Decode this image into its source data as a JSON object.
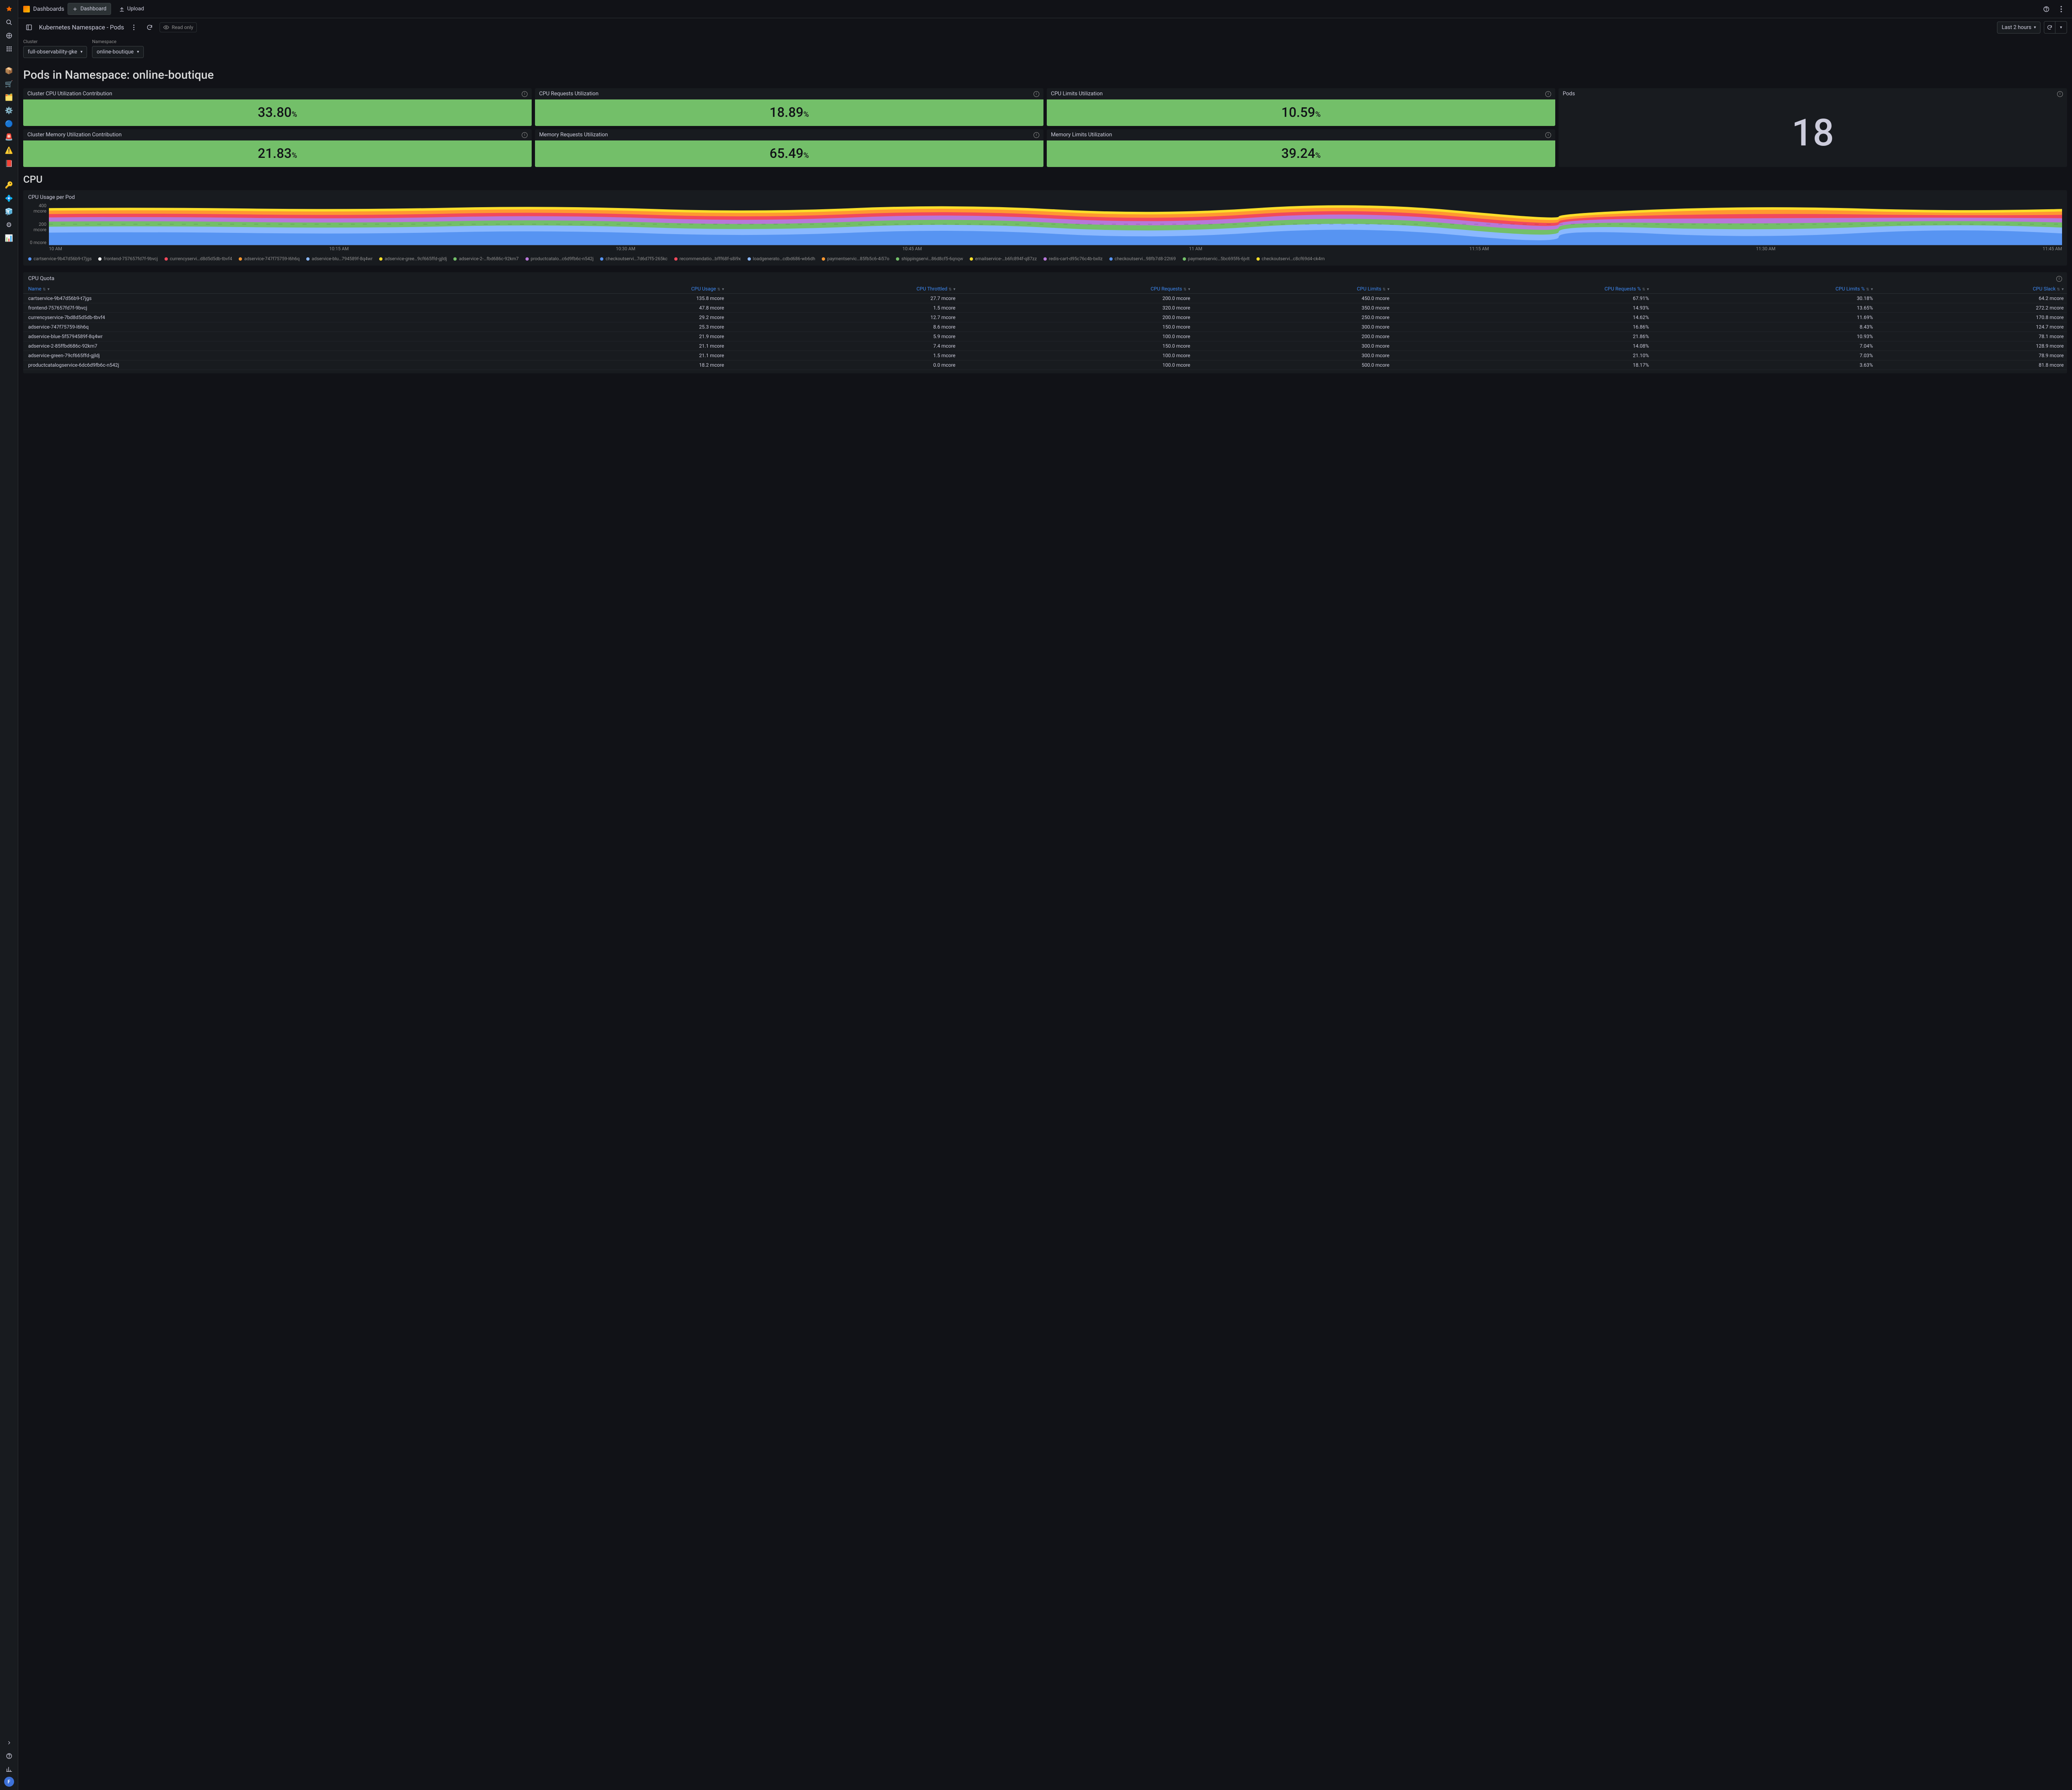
{
  "topbar": {
    "breadcrumb_root": "Dashboards",
    "new_dashboard": "Dashboard",
    "upload": "Upload"
  },
  "subheader": {
    "title": "Kubernetes Namespace - Pods",
    "readonly": "Read only",
    "timerange": "Last 2 hours"
  },
  "vars": {
    "cluster_label": "Cluster",
    "cluster_value": "full-observability-gke",
    "namespace_label": "Namespace",
    "namespace_value": "online-boutique"
  },
  "page_heading": "Pods in Namespace: online-boutique",
  "stats": {
    "cpu_cluster": {
      "title": "Cluster CPU Utilization Contribution",
      "value": "33.80",
      "suffix": "%"
    },
    "cpu_requests": {
      "title": "CPU Requests Utilization",
      "value": "18.89",
      "suffix": "%"
    },
    "cpu_limits": {
      "title": "CPU Limits Utilization",
      "value": "10.59",
      "suffix": "%"
    },
    "mem_cluster": {
      "title": "Cluster Memory Utilization Contribution",
      "value": "21.83",
      "suffix": "%"
    },
    "mem_requests": {
      "title": "Memory Requests Utilization",
      "value": "65.49",
      "suffix": "%"
    },
    "mem_limits": {
      "title": "Memory Limits Utilization",
      "value": "39.24",
      "suffix": "%"
    },
    "pods": {
      "title": "Pods",
      "value": "18"
    }
  },
  "section_cpu": "CPU",
  "chart": {
    "title": "CPU Usage per Pod",
    "ylabels": [
      "400 mcore",
      "200 mcore",
      "0 mcore"
    ],
    "xlabels": [
      "10 AM",
      "10:15 AM",
      "10:30 AM",
      "10:45 AM",
      "11 AM",
      "11:15 AM",
      "11:30 AM",
      "11:45 AM"
    ]
  },
  "legend": [
    {
      "c": "#5794f2",
      "t": "cartservice-9b47d56b9-t7jgs"
    },
    {
      "c": "#ffffff",
      "t": "frontend-757657fd7f-9bvcj"
    },
    {
      "c": "#f2495c",
      "t": "currencyservi…d8d5d5db-tbvf4"
    },
    {
      "c": "#ff9830",
      "t": "adservice-747f75759-l6h6q"
    },
    {
      "c": "#8ab8ff",
      "t": "adservice-blu…794589f-8q4wr"
    },
    {
      "c": "#fade2a",
      "t": "adservice-gree…9cf665ffd-gjldj"
    },
    {
      "c": "#73bf69",
      "t": "adservice-2-…fbd686c-92km7"
    },
    {
      "c": "#b877d9",
      "t": "productcatalo…c6d9fb6c-n542j"
    },
    {
      "c": "#5794f2",
      "t": "checkoutservi…7d6d7f5-265kc"
    },
    {
      "c": "#f2495c",
      "t": "recommendatio…bfff68f-s8i9x"
    },
    {
      "c": "#8ab8ff",
      "t": "loadgenerato…cdbd686-wb6dh"
    },
    {
      "c": "#ff9830",
      "t": "paymentservic…85fb5c6-4i57o"
    },
    {
      "c": "#73bf69",
      "t": "shippingservi…86d8cf5-6qnqw"
    },
    {
      "c": "#fade2a",
      "t": "emailservice-…b6fc894f-q87zz"
    },
    {
      "c": "#b877d9",
      "t": "redis-cart-d95c76c4b-bxllz"
    },
    {
      "c": "#5794f2",
      "t": "checkoutservi…98fb7d8-22t69"
    },
    {
      "c": "#73bf69",
      "t": "paymentservic…5bc695f6-6jvlt"
    },
    {
      "c": "#fade2a",
      "t": "checkoutservi…c8cf69d4-ck4rn"
    }
  ],
  "table": {
    "title": "CPU Quota",
    "headers": [
      "Name",
      "CPU Usage",
      "CPU Throttled",
      "CPU Requests",
      "CPU Limits",
      "CPU Requests %",
      "CPU Limits %",
      "CPU Slack"
    ],
    "rows": [
      [
        "cartservice-9b47d56b9-t7jgs",
        "135.8 mcore",
        "27.7 mcore",
        "200.0 mcore",
        "450.0 mcore",
        "67.91%",
        "30.18%",
        "64.2 mcore"
      ],
      [
        "frontend-757657fd7f-9bvcj",
        "47.8 mcore",
        "1.5 mcore",
        "320.0 mcore",
        "350.0 mcore",
        "14.93%",
        "13.65%",
        "272.2 mcore"
      ],
      [
        "currencyservice-7bd8d5d5db-tbvf4",
        "29.2 mcore",
        "12.7 mcore",
        "200.0 mcore",
        "250.0 mcore",
        "14.62%",
        "11.69%",
        "170.8 mcore"
      ],
      [
        "adservice-747f75759-l6h6q",
        "25.3 mcore",
        "8.6 mcore",
        "150.0 mcore",
        "300.0 mcore",
        "16.86%",
        "8.43%",
        "124.7 mcore"
      ],
      [
        "adservice-blue-5f5794589f-8q4wr",
        "21.9 mcore",
        "5.9 mcore",
        "100.0 mcore",
        "200.0 mcore",
        "21.86%",
        "10.93%",
        "78.1 mcore"
      ],
      [
        "adservice-2-85ffbd686c-92km7",
        "21.1 mcore",
        "7.4 mcore",
        "150.0 mcore",
        "300.0 mcore",
        "14.08%",
        "7.04%",
        "128.9 mcore"
      ],
      [
        "adservice-green-79cf665ffd-gjldj",
        "21.1 mcore",
        "1.5 mcore",
        "100.0 mcore",
        "300.0 mcore",
        "21.10%",
        "7.03%",
        "78.9 mcore"
      ],
      [
        "productcatalogservice-6dc6d9fb6c-n542j",
        "18.2 mcore",
        "0.0 mcore",
        "100.0 mcore",
        "500.0 mcore",
        "18.17%",
        "3.63%",
        "81.8 mcore"
      ]
    ]
  },
  "chart_data": {
    "type": "area",
    "title": "CPU Usage per Pod",
    "xlabel": "",
    "ylabel": "mcore",
    "ylim": [
      0,
      450
    ],
    "x_ticks": [
      "10 AM",
      "10:15 AM",
      "10:30 AM",
      "10:45 AM",
      "11 AM",
      "11:15 AM",
      "11:30 AM",
      "11:45 AM"
    ],
    "note": "stacked area; approximate total hovers around 400 mcore with small fluctuations",
    "series_names": [
      "cartservice",
      "frontend",
      "currencyservice",
      "adservice",
      "adservice-blue",
      "adservice-green",
      "adservice-2",
      "productcatalogservice",
      "checkoutservice",
      "recommendation",
      "loadgenerator",
      "paymentservice",
      "shippingservice",
      "emailservice",
      "redis-cart",
      "checkoutservice-2",
      "paymentservice-2",
      "checkoutservice-3"
    ]
  }
}
